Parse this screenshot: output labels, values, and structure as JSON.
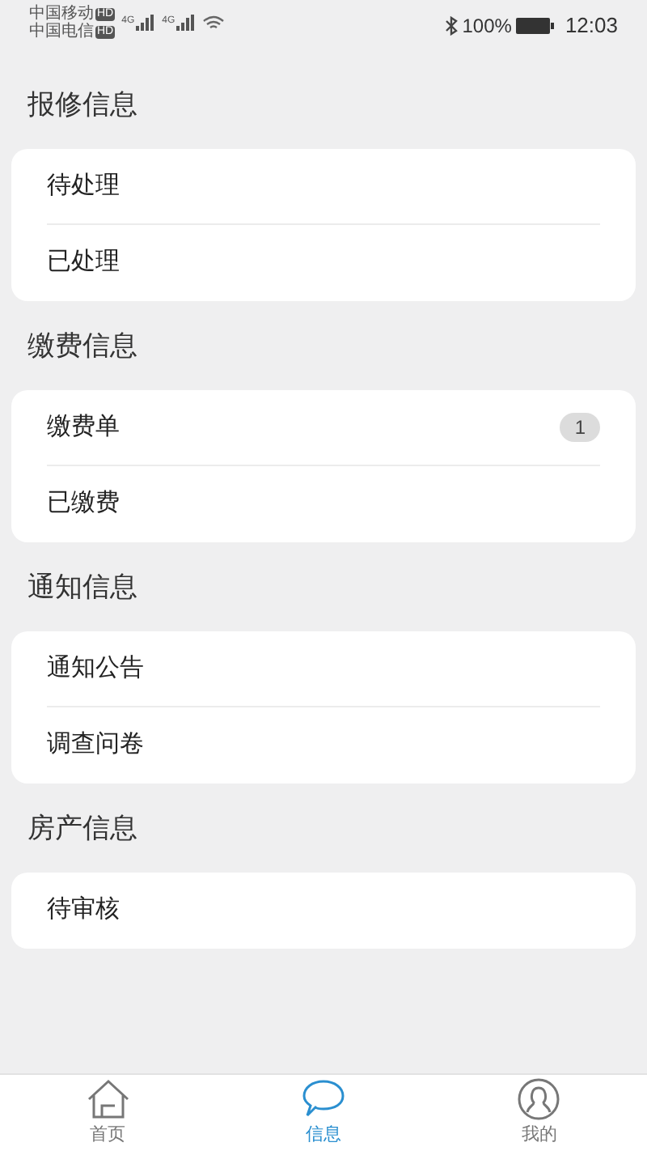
{
  "status_bar": {
    "carriers": [
      {
        "name": "中国移动",
        "badge": "HD"
      },
      {
        "name": "中国电信",
        "badge": "HD"
      }
    ],
    "networks": [
      "4G",
      "4G"
    ],
    "battery": "100%",
    "time": "12:03"
  },
  "sections": [
    {
      "title": "报修信息",
      "items": [
        {
          "label": "待处理"
        },
        {
          "label": "已处理"
        }
      ]
    },
    {
      "title": "缴费信息",
      "items": [
        {
          "label": "缴费单",
          "count": "1"
        },
        {
          "label": "已缴费"
        }
      ]
    },
    {
      "title": "通知信息",
      "items": [
        {
          "label": "通知公告"
        },
        {
          "label": "调查问卷"
        }
      ]
    },
    {
      "title": "房产信息",
      "items": [
        {
          "label": "待审核"
        }
      ]
    }
  ],
  "tab_bar": [
    {
      "label": "首页",
      "kind": "home",
      "selected": false
    },
    {
      "label": "信息",
      "kind": "chat",
      "selected": true
    },
    {
      "label": "我的",
      "kind": "user",
      "selected": false
    }
  ]
}
